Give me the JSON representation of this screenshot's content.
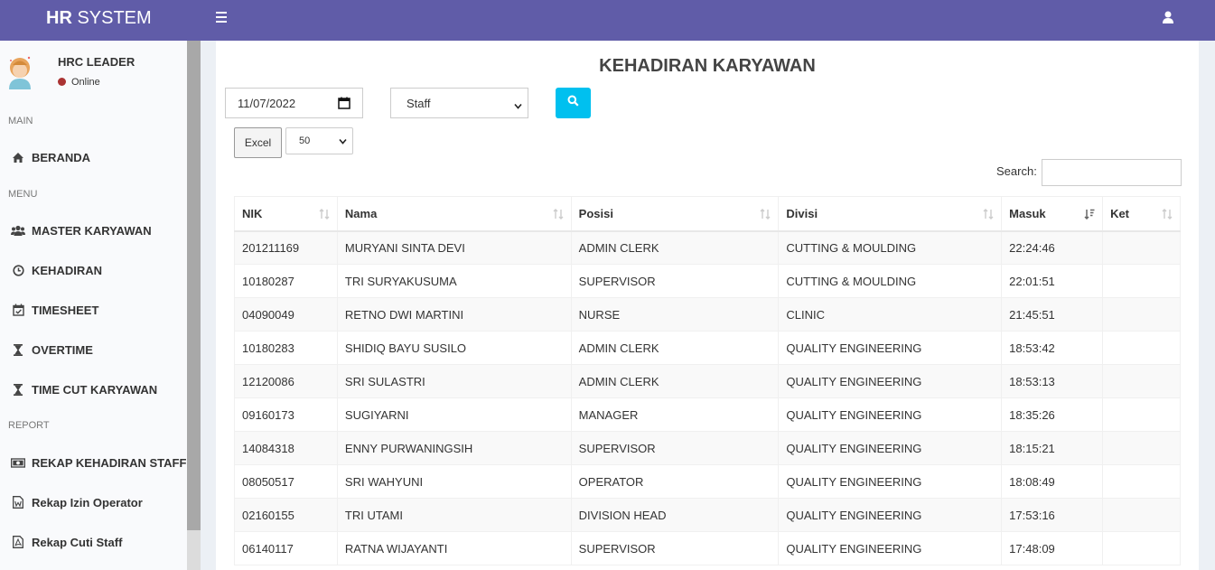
{
  "app": {
    "logo_bold": "HR",
    "logo_rest": " SYSTEM"
  },
  "user": {
    "name": "HRC LEADER",
    "status": "Online"
  },
  "sidebar": {
    "sections": {
      "main": "MAIN",
      "menu": "MENU",
      "report": "REPORT"
    },
    "items": [
      {
        "label": "BERANDA",
        "icon": "home-icon"
      },
      {
        "label": "MASTER KARYAWAN",
        "icon": "users-icon"
      },
      {
        "label": "KEHADIRAN",
        "icon": "clock-icon"
      },
      {
        "label": "TIMESHEET",
        "icon": "calendar-check-icon"
      },
      {
        "label": "OVERTIME",
        "icon": "hourglass-icon"
      },
      {
        "label": "TIME CUT KARYAWAN",
        "icon": "hourglass-icon"
      },
      {
        "label": "REKAP KEHADIRAN STAFF",
        "icon": "money-icon"
      },
      {
        "label": "Rekap Izin Operator",
        "icon": "file-word-icon"
      },
      {
        "label": "Rekap Cuti Staff",
        "icon": "file-pdf-icon"
      }
    ]
  },
  "page": {
    "title": "KEHADIRAN KARYAWAN"
  },
  "filters": {
    "date_value": "11/07/2022",
    "category_value": "Staff",
    "excel_label": "Excel",
    "page_length": "50",
    "search_label": "Search:",
    "search_value": ""
  },
  "table": {
    "columns": [
      "NIK",
      "Nama",
      "Posisi",
      "Divisi",
      "Masuk",
      "Ket"
    ],
    "rows": [
      [
        "201211169",
        "MURYANI SINTA DEVI",
        "ADMIN CLERK",
        "CUTTING & MOULDING",
        "22:24:46",
        ""
      ],
      [
        "10180287",
        "TRI SURYAKUSUMA",
        "SUPERVISOR",
        "CUTTING & MOULDING",
        "22:01:51",
        ""
      ],
      [
        "04090049",
        "RETNO DWI MARTINI",
        "NURSE",
        "CLINIC",
        "21:45:51",
        ""
      ],
      [
        "10180283",
        "SHIDIQ BAYU SUSILO",
        "ADMIN CLERK",
        "QUALITY ENGINEERING",
        "18:53:42",
        ""
      ],
      [
        "12120086",
        "SRI SULASTRI",
        "ADMIN CLERK",
        "QUALITY ENGINEERING",
        "18:53:13",
        ""
      ],
      [
        "09160173",
        "SUGIYARNI",
        "MANAGER",
        "QUALITY ENGINEERING",
        "18:35:26",
        ""
      ],
      [
        "14084318",
        "ENNY PURWANINGSIH",
        "SUPERVISOR",
        "QUALITY ENGINEERING",
        "18:15:21",
        ""
      ],
      [
        "08050517",
        "SRI WAHYUNI",
        "OPERATOR",
        "QUALITY ENGINEERING",
        "18:08:49",
        ""
      ],
      [
        "02160155",
        "TRI UTAMI",
        "DIVISION HEAD",
        "QUALITY ENGINEERING",
        "17:53:16",
        ""
      ],
      [
        "06140117",
        "RATNA WIJAYANTI",
        "SUPERVISOR",
        "QUALITY ENGINEERING",
        "17:48:09",
        ""
      ]
    ]
  },
  "colors": {
    "header": "#605ca8",
    "accent_button": "#00c0ef",
    "status_offline": "#aa3333"
  }
}
